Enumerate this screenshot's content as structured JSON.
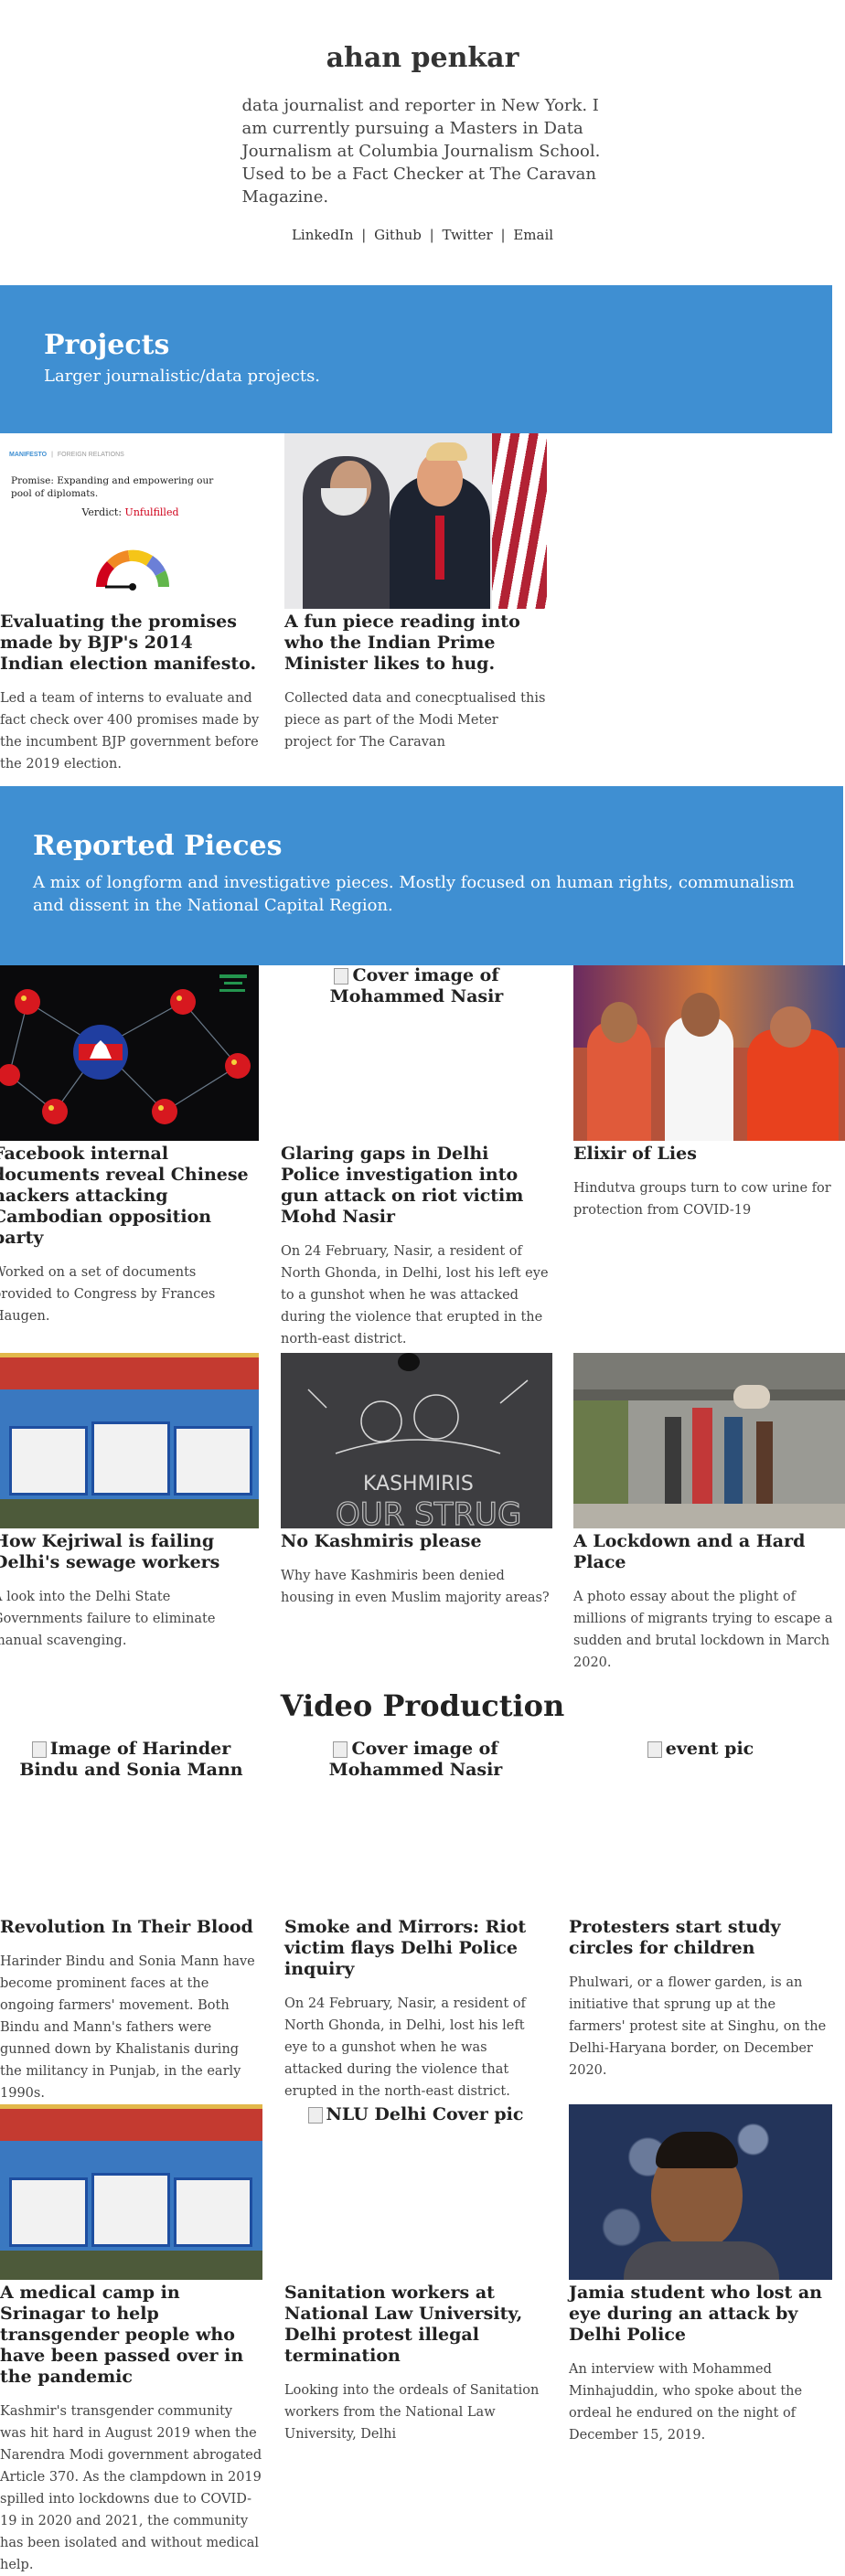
{
  "header": {
    "name": "ahan penkar",
    "bio": "data journalist and reporter in New York. I am currently pursuing a Masters in Data Journalism at Columbia Journalism School. Used to be a Fact Checker at The Caravan Magazine.",
    "links": [
      "LinkedIn",
      "Github",
      "Twitter",
      "Email"
    ],
    "link_separator": "|"
  },
  "projects": {
    "title": "Projects",
    "subtitle": "Larger journalistic/data projects.",
    "cards": [
      {
        "title": "Evaluating the promises made by BJP's 2014 Indian election manifesto.",
        "desc": "Led a team of interns to evaluate and fact check over 400 promises made by the incumbent BJP government before the 2019 election.",
        "thumb": {
          "tab_left": "MANIFESTO",
          "tab_right": "FOREIGN RELATIONS",
          "promise": "Promise: Expanding and empowering our pool of diplomats.",
          "verdict_label": "Verdict:",
          "verdict_value": "Unfulfilled",
          "gauge_level": 0
        }
      },
      {
        "title": "A fun piece reading into who the Indian Prime Minister likes to hug.",
        "desc": "Collected data and conecptualised this piece as part of the Modi Meter project for The Caravan"
      }
    ]
  },
  "reported": {
    "title": "Reported Pieces",
    "subtitle": "A mix of longform and investigative pieces. Mostly focused on human rights, communalism and dissent in the National Capital Region.",
    "cards": [
      {
        "title": "Facebook internal documents reveal Chinese hackers attacking Cambodian opposition party",
        "desc": "Worked on a set of documents provided to Congress by Frances Haugen."
      },
      {
        "alt": "Cover image of Mohammed Nasir",
        "title": "Glaring gaps in Delhi Police investigation into gun attack on riot victim Mohd Nasir",
        "desc": "On 24 February, Nasir, a resident of North Ghonda, in Delhi, lost his left eye to a gunshot when he was attacked during the violence that erupted in the north-east district."
      },
      {
        "title": "Elixir of Lies",
        "desc": "Hindutva groups turn to cow urine for protection from COVID-19"
      },
      {
        "title": "How Kejriwal is failing Delhi's sewage workers",
        "desc": "A look into the Delhi State Governments failure to eliminate manual scavenging."
      },
      {
        "title": "No Kashmiris please",
        "desc": "Why have Kashmiris been denied housing in even Muslim majority areas?",
        "thumb_text": [
          "KASHMIRIS",
          "OUR STRUG"
        ]
      },
      {
        "title": "A Lockdown and a Hard Place",
        "desc": "A photo essay about the plight of millions of migrants trying to escape a sudden and brutal lockdown in March 2020."
      }
    ]
  },
  "video": {
    "title": "Video Production",
    "cards": [
      {
        "alt": "Image of Harinder Bindu and Sonia Mann",
        "title": "Revolution In Their Blood",
        "desc": "Harinder Bindu and Sonia Mann have become prominent faces at the ongoing farmers' movement. Both Bindu and Mann's fathers were gunned down by Khalistanis during the militancy in Punjab, in the early 1990s."
      },
      {
        "alt": "Cover image of Mohammed Nasir",
        "title": "Smoke and Mirrors: Riot victim flays Delhi Police inquiry",
        "desc": "On 24 February, Nasir, a resident of North Ghonda, in Delhi, lost his left eye to a gunshot when he was attacked during the violence that erupted in the north-east district."
      },
      {
        "alt": "event pic",
        "title": "Protesters start study circles for children",
        "desc": "Phulwari, or a flower garden, is an initiative that sprung up at the farmers' protest site at Singhu, on the Delhi-Haryana border, on December 2020."
      },
      {
        "title": "A medical camp in Srinagar to help transgender people who have been passed over in the pandemic",
        "desc": "Kashmir's transgender community was hit hard in August 2019 when the Narendra Modi government abrogated Article 370. As the clampdown in 2019 spilled into lockdowns due to COVID-19 in 2020 and 2021, the community has been isolated and without medical help."
      },
      {
        "alt": "NLU Delhi Cover pic",
        "title": "Sanitation workers at National Law University, Delhi protest illegal termination",
        "desc": "Looking into the ordeals of Sanitation workers from the National Law University, Delhi"
      },
      {
        "title": "Jamia student who lost an eye during an attack by Delhi Police",
        "desc": "An interview with Mohammed Minhajuddin, who spoke about the ordeal he endured on the night of December 15, 2019."
      }
    ]
  },
  "colors": {
    "band": "#3f8fd2",
    "text": "#333333",
    "verdict": "#d0021b"
  }
}
